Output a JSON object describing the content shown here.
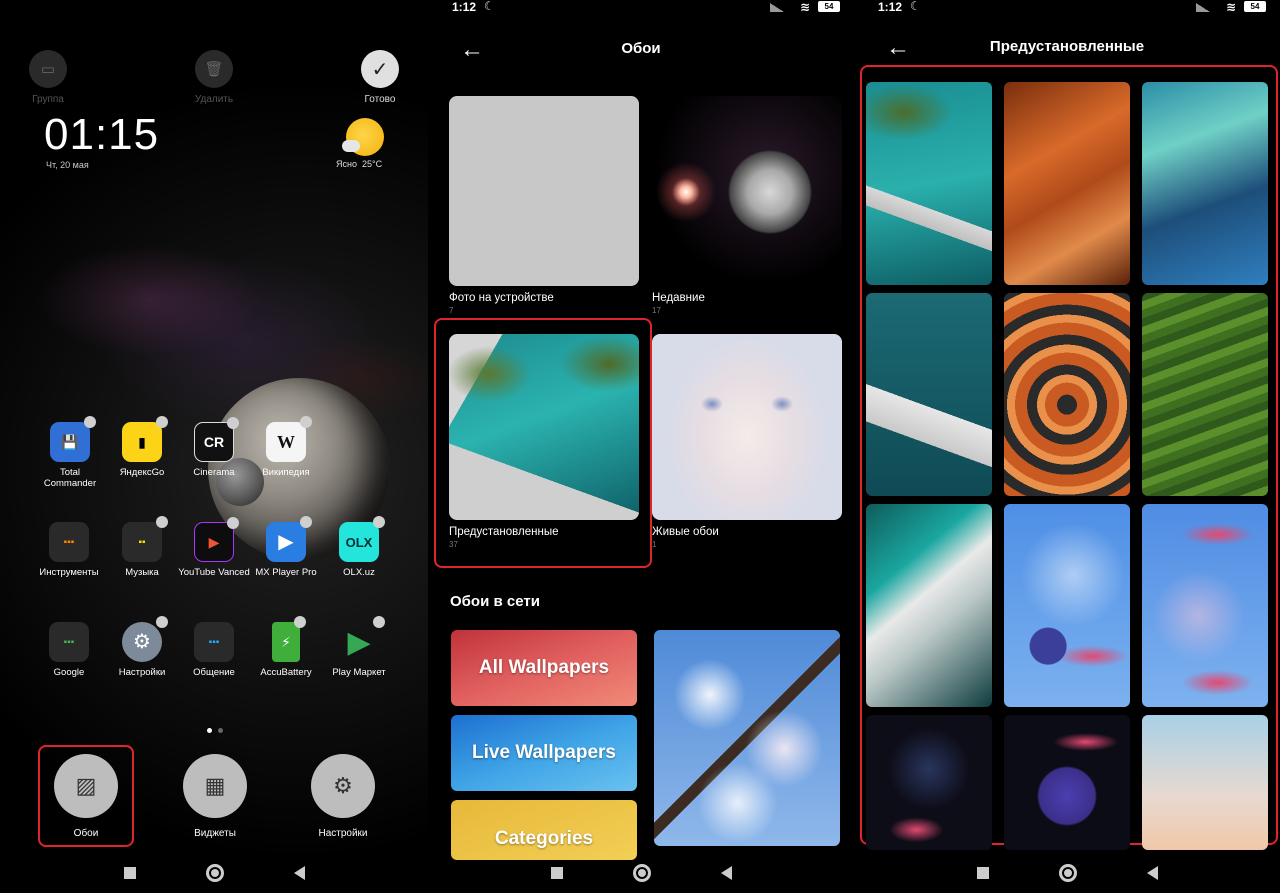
{
  "status": {
    "time": "1:12",
    "battery": "54"
  },
  "panel1": {
    "tools": [
      {
        "label": "Группа",
        "icon": "folder-icon"
      },
      {
        "label": "Удалить",
        "icon": "trash-icon"
      },
      {
        "label": "Готово",
        "icon": "check-icon"
      }
    ],
    "clock": "01:15",
    "date": "Чт, 20 мая",
    "weather": {
      "label": "Ясно",
      "temp": "25°C"
    },
    "apps": [
      {
        "label": "Total Commander",
        "color": "#2f6fd6"
      },
      {
        "label": "ЯндексGo",
        "color": "#fcd316"
      },
      {
        "label": "Cinerama",
        "color": "#222222"
      },
      {
        "label": "Википедия",
        "color": "#f5f5f5"
      },
      {
        "label": "Инструменты",
        "color": "#2a2a2a"
      },
      {
        "label": "Музыка",
        "color": "#2a2a2a"
      },
      {
        "label": "YouTube Vanced",
        "color": "#0d0d0d"
      },
      {
        "label": "MX Player Pro",
        "color": "#2a7de1"
      },
      {
        "label": "OLX.uz",
        "color": "#23e5db"
      },
      {
        "label": "Google",
        "color": "#2a2a2a"
      },
      {
        "label": "Настройки",
        "color": "#7d8a99"
      },
      {
        "label": "Общение",
        "color": "#2a2a2a"
      },
      {
        "label": "AccuBattery",
        "color": "#3fae3a"
      },
      {
        "label": "Play Маркет",
        "color": "#111111"
      }
    ],
    "bottom_options": [
      {
        "label": "Обои",
        "icon": "wallpaper-icon"
      },
      {
        "label": "Виджеты",
        "icon": "widgets-icon"
      },
      {
        "label": "Настройки",
        "icon": "gear-icon"
      }
    ]
  },
  "panel2": {
    "title": "Обои",
    "tiles": [
      {
        "label": "Фото на устройстве",
        "count": "7"
      },
      {
        "label": "Недавние",
        "count": "17"
      },
      {
        "label": "Предустановленные",
        "count": "37"
      },
      {
        "label": "Живые обои",
        "count": "1"
      }
    ],
    "online_title": "Обои в сети",
    "banners": [
      "All Wallpapers",
      "Live Wallpapers",
      "Categories"
    ]
  },
  "panel3": {
    "title": "Предустановленные"
  },
  "colors": {
    "highlight": "#e0242e"
  }
}
